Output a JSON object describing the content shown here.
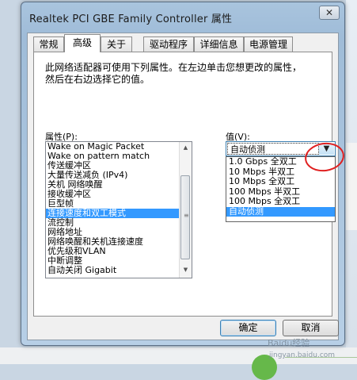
{
  "window": {
    "title": "Realtek PCI GBE Family Controller 属性",
    "close_glyph": "✕"
  },
  "tabs": [
    {
      "label": "常规"
    },
    {
      "label": "高级"
    },
    {
      "label": "关于"
    },
    {
      "label": "驱动程序"
    },
    {
      "label": "详细信息"
    },
    {
      "label": "电源管理"
    }
  ],
  "active_tab": "高级",
  "description": {
    "line1": "此网络适配器可使用下列属性。在左边单击您想更改的属性，",
    "line2": "然后在右边选择它的值。"
  },
  "property": {
    "label": "属性(P):",
    "items": [
      "Wake on Magic Packet",
      "Wake on pattern match",
      "传送缓冲区",
      "大量传送减负 (IPv4)",
      "关机 网络唤醒",
      "接收缓冲区",
      "巨型帧",
      "连接速度和双工模式",
      "流控制",
      "网络地址",
      "网络唤醒和关机连接速度",
      "优先级和VLAN",
      "中断调整",
      "自动关闭 Gigabit"
    ],
    "selected_index": 7
  },
  "value": {
    "label": "值(V):",
    "current": "自动侦测",
    "options": [
      "1.0 Gbps 全双工",
      "10 Mbps 半双工",
      "10 Mbps 全双工",
      "100 Mbps 半双工",
      "100 Mbps 全双工",
      "自动侦测"
    ],
    "selected_index": 5
  },
  "buttons": {
    "ok": "确定",
    "cancel": "取消"
  },
  "watermark": {
    "main": "Baidu经验",
    "sub": "jingyan.baidu.com"
  },
  "colors": {
    "selection": "#3399ff",
    "annotation": "#e02020"
  },
  "icons": {
    "close": "close-icon",
    "dropdown": "chevron-down-icon",
    "scroll_up": "arrow-up-icon",
    "scroll_down": "arrow-down-icon"
  }
}
